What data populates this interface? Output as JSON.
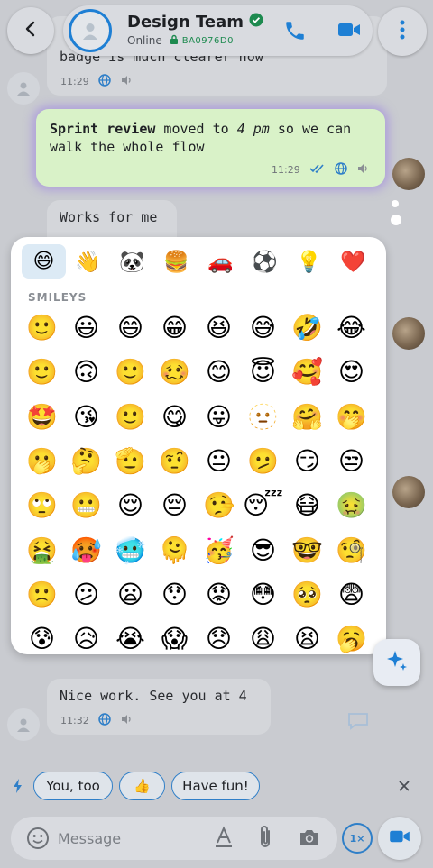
{
  "header": {
    "title": "Design Team",
    "status": "Online",
    "badge_code": "BA0976D0"
  },
  "messages": [
    {
      "text": "badge is much clearer now",
      "time": "11:29"
    },
    {
      "bold": "Sprint review",
      "mid": " moved to ",
      "italic": "4 pm",
      "rest": " so we can walk the whole flow",
      "time": "11:29"
    },
    {
      "text": "Works for me"
    },
    {
      "text": "Nice work. See you at 4",
      "time": "11:32"
    }
  ],
  "emoji_picker": {
    "tabs": [
      "😄",
      "👋",
      "🐼",
      "🍔",
      "🚗",
      "⚽",
      "💡",
      "❤️"
    ],
    "active_tab": 0,
    "section_label": "SMILEYS",
    "emojis": [
      "🙂",
      "😃",
      "😄",
      "😁",
      "😆",
      "😅",
      "🤣",
      "😂",
      "🙂",
      "🙃",
      "🙂",
      "🥴",
      "😊",
      "😇",
      "🥰",
      "😍",
      "🤩",
      "😘",
      "🙂",
      "😋",
      "😛",
      "🫥",
      "🤗",
      "🤭",
      "🫢",
      "🤔",
      "🫡",
      "🤨",
      "😐",
      "🫤",
      "😏",
      "😒",
      "🙄",
      "😬",
      "😌",
      "😔",
      "🤥",
      "😴",
      "😷",
      "🤢",
      "🤮",
      "🥵",
      "🥶",
      "🫠",
      "🥳",
      "😎",
      "🤓",
      "🧐",
      "🙁",
      "😕",
      "😦",
      "😯",
      "😟",
      "😳",
      "🥺",
      "😨",
      "😰",
      "😥",
      "😭",
      "😱",
      "😞",
      "😩",
      "😫",
      "🥱"
    ]
  },
  "quick_replies": [
    "You, too",
    "👍",
    "Have fun!"
  ],
  "input": {
    "placeholder": "Message",
    "speed_label": "1×"
  },
  "colors": {
    "accent": "#1e7fd4",
    "outgoing_bubble": "#d9f2c8",
    "verified": "#1d8a4f"
  }
}
